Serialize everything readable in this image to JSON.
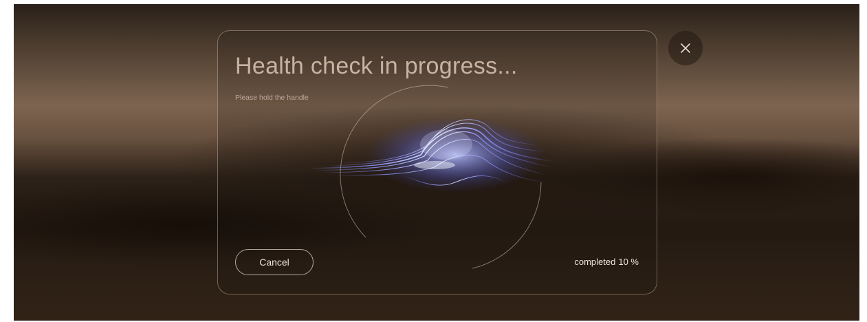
{
  "dialog": {
    "title": "Health check in progress...",
    "subtitle": "Please hold the handle",
    "cancel_label": "Cancel",
    "progress_label": "completed",
    "progress_value": "10 %",
    "progress_fraction": 0.1
  },
  "icons": {
    "close": "close-icon",
    "visualization": "waveform-visualization"
  },
  "colors": {
    "title": "#c7b3a3",
    "text": "#efe3d8",
    "wave": "#6f78e8",
    "wave_highlight": "#e6ebff"
  }
}
